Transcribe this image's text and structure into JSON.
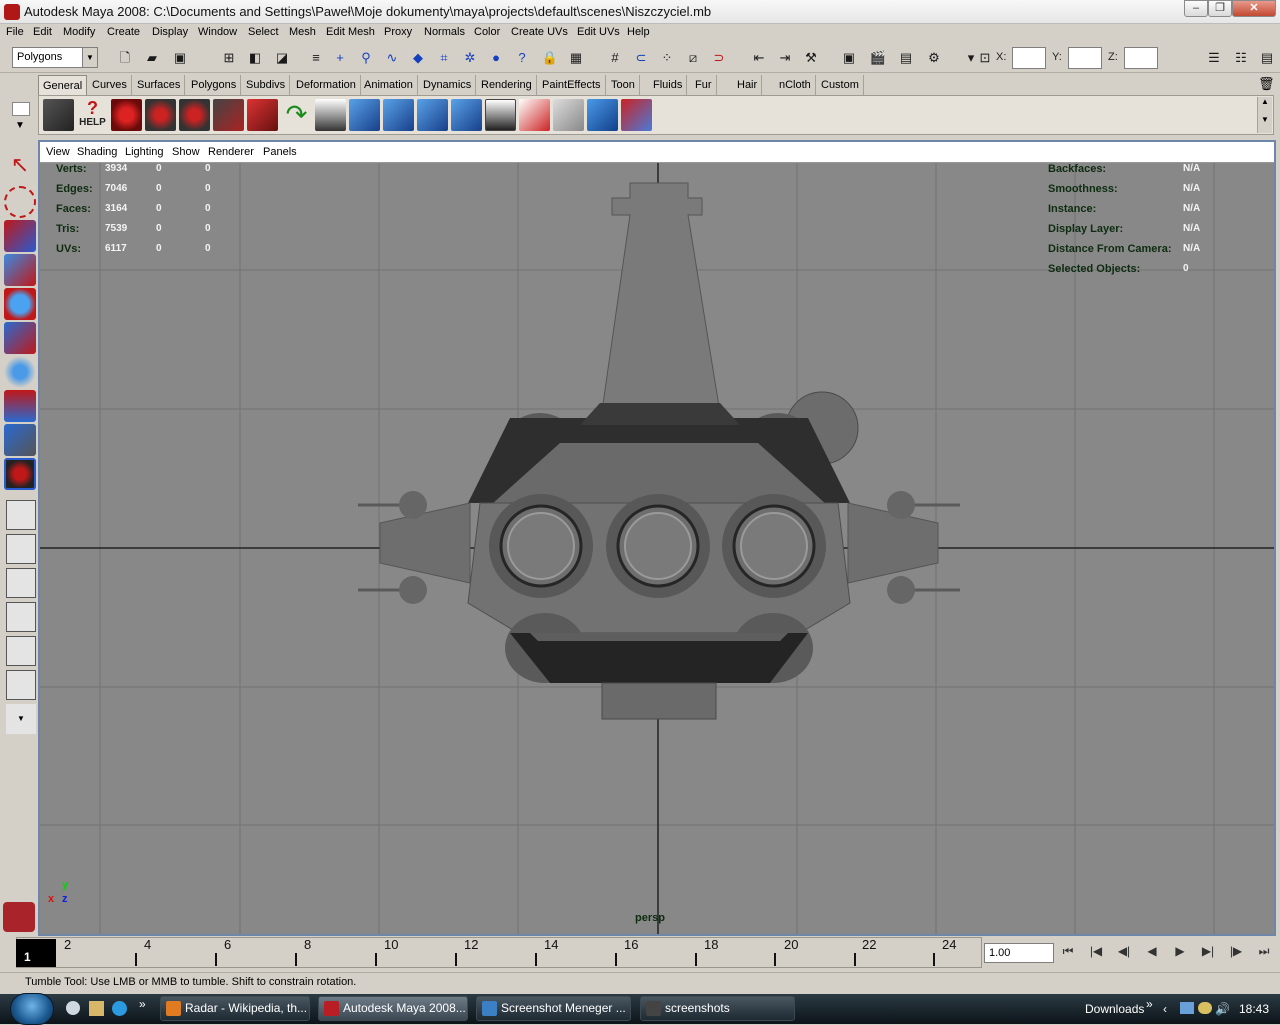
{
  "window": {
    "title": "Autodesk Maya 2008: C:\\Documents and Settings\\Paweł\\Moje dokumenty\\maya\\projects\\default\\scenes\\Niszczyciel.mb",
    "minimize_glyph": "–",
    "maximize_glyph": "❐",
    "close_glyph": "✕"
  },
  "menubar": [
    "File",
    "Edit",
    "Modify",
    "Create",
    "Display",
    "Window",
    "Select",
    "Mesh",
    "Edit Mesh",
    "Proxy",
    "Normals",
    "Color",
    "Create UVs",
    "Edit UVs",
    "Help"
  ],
  "statusline": {
    "mode": "Polygons",
    "x_label": "X:",
    "y_label": "Y:",
    "z_label": "Z:"
  },
  "shelf": {
    "tabs": [
      "General",
      "Curves",
      "Surfaces",
      "Polygons",
      "Subdivs",
      "Deformation",
      "Animation",
      "Dynamics",
      "Rendering",
      "PaintEffects",
      "Toon",
      "Fluids",
      "Fur",
      "Hair",
      "nCloth",
      "Custom"
    ],
    "active_tab": "General",
    "help_label": "HELP"
  },
  "viewport": {
    "menu": [
      "View",
      "Shading",
      "Lighting",
      "Show",
      "Renderer",
      "Panels"
    ],
    "camera": "persp",
    "axis": {
      "x": "x",
      "y": "y",
      "z": "z"
    },
    "poly_count": [
      {
        "label": "Verts:",
        "total": "3934",
        "sel": "0",
        "comp": "0"
      },
      {
        "label": "Edges:",
        "total": "7046",
        "sel": "0",
        "comp": "0"
      },
      {
        "label": "Faces:",
        "total": "3164",
        "sel": "0",
        "comp": "0"
      },
      {
        "label": "Tris:",
        "total": "7539",
        "sel": "0",
        "comp": "0"
      },
      {
        "label": "UVs:",
        "total": "6117",
        "sel": "0",
        "comp": "0"
      }
    ],
    "object_details": [
      {
        "label": "Backfaces:",
        "value": "N/A"
      },
      {
        "label": "Smoothness:",
        "value": "N/A"
      },
      {
        "label": "Instance:",
        "value": "N/A"
      },
      {
        "label": "Display Layer:",
        "value": "N/A"
      },
      {
        "label": "Distance From Camera:",
        "value": "N/A"
      },
      {
        "label": "Selected Objects:",
        "value": "0"
      }
    ]
  },
  "timeline": {
    "current_frame": "1",
    "labels": [
      "2",
      "4",
      "6",
      "8",
      "10",
      "12",
      "14",
      "16",
      "18",
      "20",
      "22",
      "24"
    ],
    "frame_field": "1.00",
    "playback_buttons": [
      "⏮",
      "|◀",
      "◀|",
      "◀",
      "▶",
      "▶|",
      "|▶",
      "⏭"
    ]
  },
  "helpline": "Tumble Tool: Use LMB or MMB to tumble. Shift to constrain rotation.",
  "taskbar": {
    "tasks": [
      {
        "label": "Radar - Wikipedia, th...",
        "icon_color": "#e07b22"
      },
      {
        "label": "Autodesk Maya 2008...",
        "icon_color": "#b81e24"
      },
      {
        "label": "Screenshot Meneger ...",
        "icon_color": "#3b7fc4"
      },
      {
        "label": "screenshots",
        "icon_color": "#444444"
      }
    ],
    "downloads": "Downloads",
    "clock": "18:43",
    "more_glyph": "»"
  },
  "colors": {
    "viewport_bg": "#888888",
    "grid": "#707070",
    "hud_text": "#0e2c10",
    "model": "#7a7a7a",
    "model_dark": "#2a2a2a"
  }
}
